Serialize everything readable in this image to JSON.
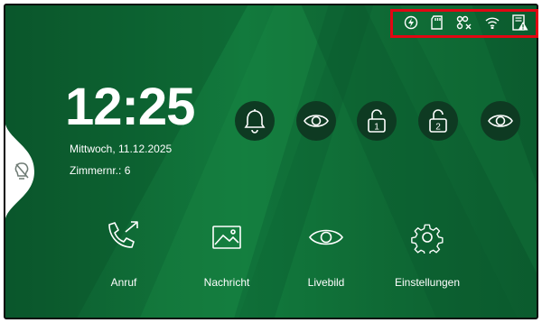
{
  "status_bar": {
    "icons": [
      "energy-saving-icon",
      "sd-card-icon",
      "network-disconnected-icon",
      "wifi-icon",
      "device-warning-icon"
    ],
    "highlight_color": "#e30613"
  },
  "clock": {
    "time": "12:25",
    "date": "Mittwoch, 11.12.2025",
    "room_label": "Zimmernr.:",
    "room_number": "6"
  },
  "quick_actions": [
    {
      "icon": "bell-icon"
    },
    {
      "icon": "eye-icon"
    },
    {
      "icon": "unlock-1-icon",
      "badge": "1"
    },
    {
      "icon": "unlock-2-icon",
      "badge": "2"
    },
    {
      "icon": "eye-icon"
    }
  ],
  "nav": [
    {
      "label": "Anruf",
      "icon": "call-icon"
    },
    {
      "label": "Nachricht",
      "icon": "image-message-icon"
    },
    {
      "label": "Livebild",
      "icon": "eye-icon"
    },
    {
      "label": "Einstellungen",
      "icon": "gear-icon"
    }
  ],
  "side_tab": {
    "icon": "lightbulb-off-icon"
  },
  "colors": {
    "background_dark": "#0b4e28",
    "background_light": "#16803f",
    "button_bg": "#0e3a22",
    "text": "#ffffff"
  }
}
